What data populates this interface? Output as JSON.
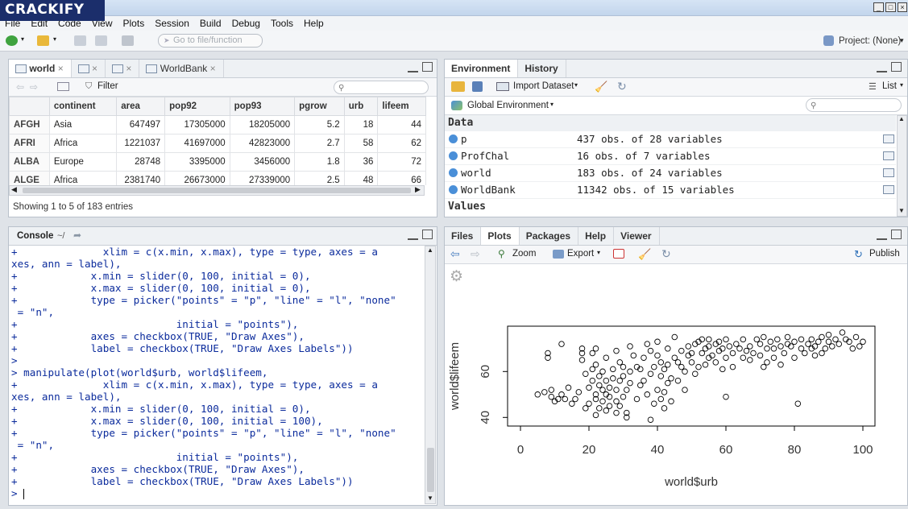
{
  "app": {
    "logo": "CRACKIFY",
    "project": "Project: (None)"
  },
  "menu": [
    "File",
    "Edit",
    "Code",
    "View",
    "Plots",
    "Session",
    "Build",
    "Debug",
    "Tools",
    "Help"
  ],
  "toolbar": {
    "goto_placeholder": "Go to file/function"
  },
  "source": {
    "tabs": [
      "world",
      "",
      "",
      "WorldBank"
    ],
    "filter_label": "Filter",
    "columns": [
      "",
      "continent",
      "area",
      "pop92",
      "pop93",
      "pgrow",
      "urb",
      "lifeem"
    ],
    "rows": [
      [
        "AFGH",
        "Asia",
        "647497",
        "17305000",
        "18205000",
        "5.2",
        "18",
        "44"
      ],
      [
        "AFRI",
        "Africa",
        "1221037",
        "41697000",
        "42823000",
        "2.7",
        "58",
        "62"
      ],
      [
        "ALBA",
        "Europe",
        "28748",
        "3395000",
        "3456000",
        "1.8",
        "36",
        "72"
      ],
      [
        "ALGE",
        "Africa",
        "2381740",
        "26673000",
        "27339000",
        "2.5",
        "48",
        "66"
      ]
    ],
    "footer": "Showing 1 to 5 of 183 entries"
  },
  "environment": {
    "tabs": [
      "Environment",
      "History"
    ],
    "import_label": "Import Dataset",
    "list_label": "List",
    "scope": "Global Environment",
    "data_header": "Data",
    "values_header": "Values",
    "items": [
      {
        "name": "p",
        "desc": "437 obs. of 28 variables"
      },
      {
        "name": "ProfChal",
        "desc": "16 obs. of 7 variables"
      },
      {
        "name": "world",
        "desc": "183 obs. of 24 variables"
      },
      {
        "name": "WorldBank",
        "desc": "11342 obs. of 15 variables"
      }
    ]
  },
  "console": {
    "title": "Console",
    "path": "~/",
    "lines": [
      "+              xlim = c(x.min, x.max), type = type, axes = a",
      "xes, ann = label),",
      "+            x.min = slider(0, 100, initial = 0),",
      "+            x.max = slider(0, 100, initial = 0),",
      "+            type = picker(\"points\" = \"p\", \"line\" = \"l\", \"none\"",
      " = \"n\",",
      "+                          initial = \"points\"),",
      "+            axes = checkbox(TRUE, \"Draw Axes\"),",
      "+            label = checkbox(TRUE, \"Draw Axes Labels\"))",
      ">",
      "> manipulate(plot(world$urb, world$lifeem,",
      "+              xlim = c(x.min, x.max), type = type, axes = a",
      "xes, ann = label),",
      "+            x.min = slider(0, 100, initial = 0),",
      "+            x.max = slider(0, 100, initial = 100),",
      "+            type = picker(\"points\" = \"p\", \"line\" = \"l\", \"none\"",
      " = \"n\",",
      "+                          initial = \"points\"),",
      "+            axes = checkbox(TRUE, \"Draw Axes\"),",
      "+            label = checkbox(TRUE, \"Draw Axes Labels\"))",
      "> "
    ]
  },
  "plots": {
    "tabs": [
      "Files",
      "Plots",
      "Packages",
      "Help",
      "Viewer"
    ],
    "zoom_label": "Zoom",
    "export_label": "Export",
    "publish_label": "Publish"
  },
  "chart_data": {
    "type": "scatter",
    "xlabel": "world$urb",
    "ylabel": "world$lifeem",
    "xlim": [
      0,
      100
    ],
    "ylim": [
      38,
      78
    ],
    "xticks": [
      0,
      20,
      40,
      60,
      80,
      100
    ],
    "yticks": [
      40,
      60
    ],
    "points": [
      [
        5,
        50
      ],
      [
        7,
        51
      ],
      [
        8,
        66
      ],
      [
        8,
        68
      ],
      [
        9,
        49
      ],
      [
        9,
        52
      ],
      [
        10,
        47
      ],
      [
        11,
        48
      ],
      [
        12,
        50
      ],
      [
        12,
        72
      ],
      [
        13,
        48
      ],
      [
        14,
        53
      ],
      [
        15,
        46
      ],
      [
        16,
        48
      ],
      [
        17,
        51
      ],
      [
        18,
        65
      ],
      [
        18,
        68
      ],
      [
        18,
        70
      ],
      [
        19,
        59
      ],
      [
        19,
        44
      ],
      [
        20,
        46
      ],
      [
        20,
        53
      ],
      [
        21,
        56
      ],
      [
        21,
        61
      ],
      [
        21,
        68
      ],
      [
        22,
        41
      ],
      [
        22,
        48
      ],
      [
        22,
        50
      ],
      [
        22,
        63
      ],
      [
        22,
        70
      ],
      [
        23,
        44
      ],
      [
        23,
        54
      ],
      [
        23,
        58
      ],
      [
        24,
        47
      ],
      [
        24,
        52
      ],
      [
        24,
        60
      ],
      [
        25,
        43
      ],
      [
        25,
        50
      ],
      [
        25,
        56
      ],
      [
        25,
        66
      ],
      [
        26,
        45
      ],
      [
        26,
        49
      ],
      [
        26,
        53
      ],
      [
        27,
        57
      ],
      [
        27,
        61
      ],
      [
        28,
        42
      ],
      [
        28,
        47
      ],
      [
        28,
        52
      ],
      [
        28,
        69
      ],
      [
        29,
        45
      ],
      [
        29,
        56
      ],
      [
        29,
        64
      ],
      [
        30,
        49
      ],
      [
        30,
        58
      ],
      [
        30,
        62
      ],
      [
        31,
        42
      ],
      [
        31,
        40
      ],
      [
        31,
        52
      ],
      [
        32,
        55
      ],
      [
        32,
        60
      ],
      [
        32,
        71
      ],
      [
        33,
        67
      ],
      [
        34,
        48
      ],
      [
        34,
        62
      ],
      [
        35,
        54
      ],
      [
        35,
        61
      ],
      [
        36,
        56
      ],
      [
        36,
        66
      ],
      [
        37,
        50
      ],
      [
        37,
        72
      ],
      [
        38,
        39
      ],
      [
        38,
        59
      ],
      [
        38,
        69
      ],
      [
        39,
        46
      ],
      [
        39,
        62
      ],
      [
        40,
        52
      ],
      [
        40,
        67
      ],
      [
        40,
        73
      ],
      [
        41,
        48
      ],
      [
        41,
        58
      ],
      [
        41,
        64
      ],
      [
        42,
        44
      ],
      [
        42,
        51
      ],
      [
        42,
        61
      ],
      [
        43,
        55
      ],
      [
        43,
        63
      ],
      [
        43,
        70
      ],
      [
        44,
        47
      ],
      [
        44,
        57
      ],
      [
        45,
        66
      ],
      [
        45,
        75
      ],
      [
        46,
        56
      ],
      [
        46,
        64
      ],
      [
        47,
        62
      ],
      [
        47,
        69
      ],
      [
        48,
        52
      ],
      [
        48,
        60
      ],
      [
        49,
        67
      ],
      [
        49,
        71
      ],
      [
        50,
        64
      ],
      [
        50,
        68
      ],
      [
        51,
        59
      ],
      [
        51,
        72
      ],
      [
        52,
        62
      ],
      [
        52,
        73
      ],
      [
        53,
        68
      ],
      [
        53,
        74
      ],
      [
        54,
        63
      ],
      [
        54,
        70
      ],
      [
        55,
        71
      ],
      [
        55,
        74
      ],
      [
        56,
        67
      ],
      [
        57,
        64
      ],
      [
        57,
        72
      ],
      [
        58,
        69
      ],
      [
        58,
        73
      ],
      [
        59,
        61
      ],
      [
        59,
        70
      ],
      [
        60,
        49
      ],
      [
        60,
        66
      ],
      [
        60,
        74
      ],
      [
        61,
        71
      ],
      [
        62,
        68
      ],
      [
        62,
        62
      ],
      [
        63,
        72
      ],
      [
        64,
        70
      ],
      [
        65,
        74
      ],
      [
        66,
        69
      ],
      [
        67,
        65
      ],
      [
        67,
        71
      ],
      [
        68,
        68
      ],
      [
        69,
        74
      ],
      [
        70,
        67
      ],
      [
        70,
        72
      ],
      [
        71,
        62
      ],
      [
        71,
        75
      ],
      [
        72,
        70
      ],
      [
        72,
        64
      ],
      [
        73,
        73
      ],
      [
        74,
        70
      ],
      [
        74,
        66
      ],
      [
        75,
        74
      ],
      [
        76,
        71
      ],
      [
        76,
        63
      ],
      [
        77,
        68
      ],
      [
        78,
        75
      ],
      [
        78,
        72
      ],
      [
        79,
        71
      ],
      [
        80,
        66
      ],
      [
        80,
        73
      ],
      [
        81,
        46
      ],
      [
        82,
        70
      ],
      [
        82,
        74
      ],
      [
        83,
        68
      ],
      [
        84,
        72
      ],
      [
        85,
        74
      ],
      [
        85,
        70
      ],
      [
        86,
        67
      ],
      [
        86,
        71
      ],
      [
        87,
        73
      ],
      [
        88,
        68
      ],
      [
        88,
        75
      ],
      [
        89,
        70
      ],
      [
        90,
        73
      ],
      [
        90,
        76
      ],
      [
        91,
        71
      ],
      [
        92,
        74
      ],
      [
        93,
        72
      ],
      [
        94,
        77
      ],
      [
        95,
        74
      ],
      [
        96,
        73
      ],
      [
        98,
        75
      ],
      [
        99,
        71
      ],
      [
        100,
        73
      ],
      [
        97,
        70
      ],
      [
        65,
        66
      ],
      [
        55,
        66
      ]
    ]
  },
  "colors": {
    "console_text": "#0b2b9c",
    "accent": "#1b2e6b"
  }
}
